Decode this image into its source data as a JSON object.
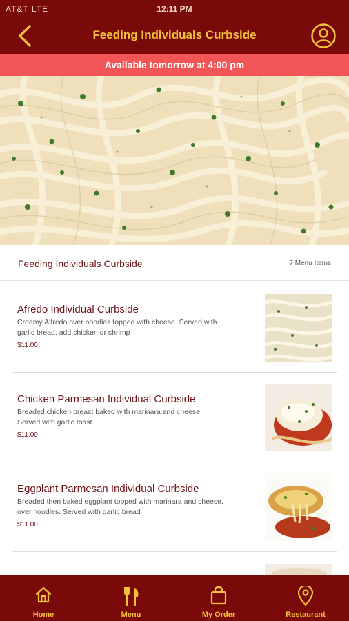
{
  "status_bar": {
    "carrier": "AT&T  LTE",
    "time": "12:11 PM"
  },
  "header": {
    "title": "Feeding Individuals Curbside",
    "back_icon": "chevron-left-icon",
    "profile_icon": "user-circle-icon"
  },
  "availability_banner": "Available tomorrow at 4:00 pm",
  "section": {
    "title": "Feeding Individuals Curbside",
    "item_count": "7 Menu Items"
  },
  "menu_items": [
    {
      "name": "Afredo Individual Curbside",
      "description": "Creamy Alfredo over noodles topped with cheese. Served with garlic bread. add chicken or shrimp",
      "price": "$11.00",
      "image": "alfredo-pasta-image"
    },
    {
      "name": "Chicken Parmesan Individual Curbside",
      "description": "Breaded chicken breast baked with marinara and cheese. Served with garlic toast",
      "price": "$11.00",
      "image": "chicken-parmesan-image"
    },
    {
      "name": "Eggplant Parmesan Individual Curbside",
      "description": "Breaded then baked eggplant topped with marinara and cheese, over noodles. Served with garlic bread",
      "price": "$11.00",
      "image": "eggplant-parmesan-image"
    }
  ],
  "tabs": [
    {
      "label": "Home",
      "icon": "home-icon"
    },
    {
      "label": "Menu",
      "icon": "fork-knife-icon"
    },
    {
      "label": "My Order",
      "icon": "shopping-bag-icon"
    },
    {
      "label": "Restaurant",
      "icon": "map-pin-icon"
    }
  ],
  "colors": {
    "header_bg": "#7a0a0a",
    "accent_gold": "#f2c23a",
    "banner_red": "#f25555",
    "item_title": "#6e1318"
  }
}
